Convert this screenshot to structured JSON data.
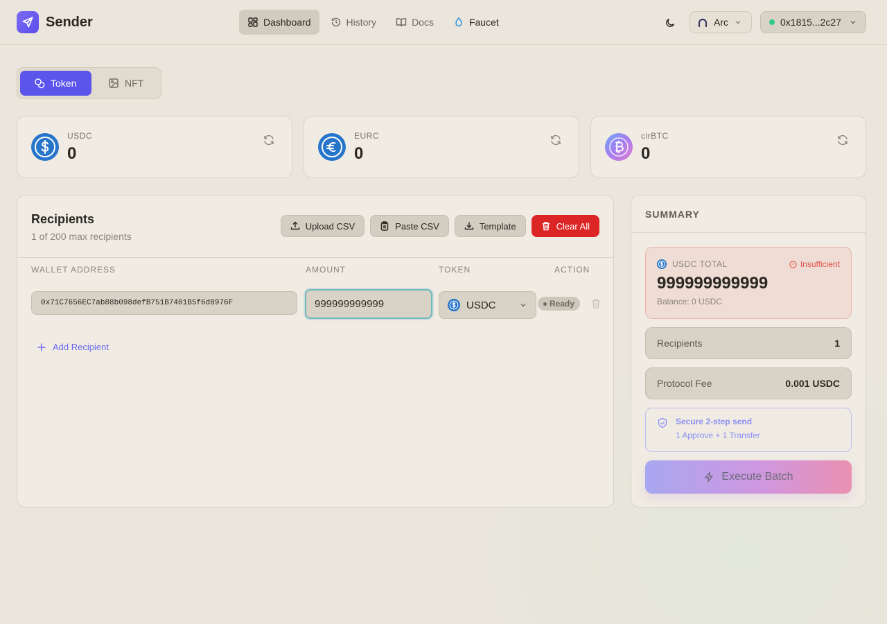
{
  "app": {
    "name": "Sender"
  },
  "nav": {
    "items": [
      {
        "label": "Dashboard",
        "icon": "dashboard-icon",
        "active": true
      },
      {
        "label": "History",
        "icon": "history-icon"
      },
      {
        "label": "Docs",
        "icon": "book-icon"
      },
      {
        "label": "Faucet",
        "icon": "droplet-icon"
      }
    ]
  },
  "network": {
    "label": "Arc"
  },
  "wallet": {
    "address": "0x1815...2c27",
    "status_color": "#2fc98a"
  },
  "asset_tabs": [
    {
      "label": "Token",
      "active": true
    },
    {
      "label": "NFT"
    }
  ],
  "balances": [
    {
      "symbol": "USDC",
      "value": "0"
    },
    {
      "symbol": "EURC",
      "value": "0"
    },
    {
      "symbol": "cirBTC",
      "value": "0"
    }
  ],
  "recipients": {
    "title": "Recipients",
    "subtitle": "1 of 200 max recipients",
    "actions": {
      "upload_csv": "Upload CSV",
      "paste_csv": "Paste CSV",
      "template": "Template",
      "clear_all": "Clear All"
    },
    "columns": {
      "wallet": "WALLET ADDRESS",
      "amount": "AMOUNT",
      "token": "TOKEN",
      "action": "ACTION"
    },
    "rows": [
      {
        "address": "0x71C7656EC7ab88b098defB751B7401B5f6d8976F",
        "amount": "999999999999",
        "token": "USDC",
        "status": "Ready"
      }
    ],
    "add_label": "Add Recipient"
  },
  "summary": {
    "heading": "SUMMARY",
    "total_label": "USDC TOTAL",
    "insufficient": "Insufficient",
    "total_value": "999999999999",
    "balance_note": "Balance: 0 USDC",
    "recipients_label": "Recipients",
    "recipients_value": "1",
    "fee_label": "Protocol Fee",
    "fee_value": "0.001 USDC",
    "secure_title": "Secure 2-step send",
    "secure_detail": "1 Approve + 1 Transfer",
    "execute_label": "Execute Batch"
  },
  "colors": {
    "accent": "#5b55ec",
    "danger": "#dc2626",
    "usdc": "#2775ca",
    "btc": "#8b7cf6"
  }
}
